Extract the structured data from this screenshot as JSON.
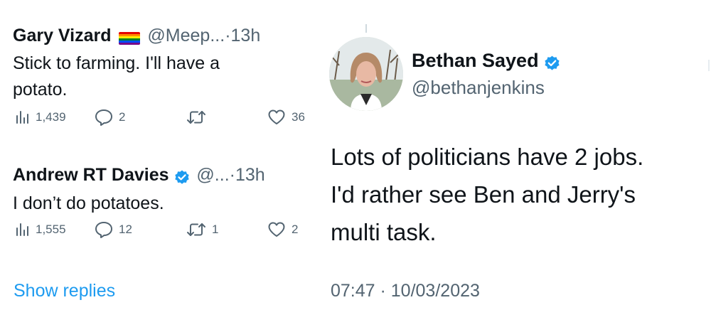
{
  "replies": [
    {
      "name": "Gary Vizard",
      "handle": "@Meep...",
      "time": "13h",
      "text_line1": "Stick to farming. I'll have a",
      "text_line2": "potato.",
      "views": "1,439",
      "replies": "2",
      "retweets": "",
      "likes": "36"
    },
    {
      "name": "Andrew RT Davies",
      "handle": "@...",
      "time": "13h",
      "text_line1": "I don’t do potatoes.",
      "views": "1,555",
      "replies": "12",
      "retweets": "1",
      "likes": "2"
    }
  ],
  "show_replies": "Show replies",
  "main_tweet": {
    "name": "Bethan Sayed",
    "handle": "@bethanjenkins",
    "text_line1": "Lots of politicians have 2 jobs.",
    "text_line2": "I'd rather see Ben and Jerry's",
    "text_line3": "multi task.",
    "timestamp": "07:47 · 10/03/2023"
  },
  "separator": "·",
  "colors": {
    "accent": "#1d9bf0",
    "muted": "#536471",
    "text": "#0f1419"
  }
}
